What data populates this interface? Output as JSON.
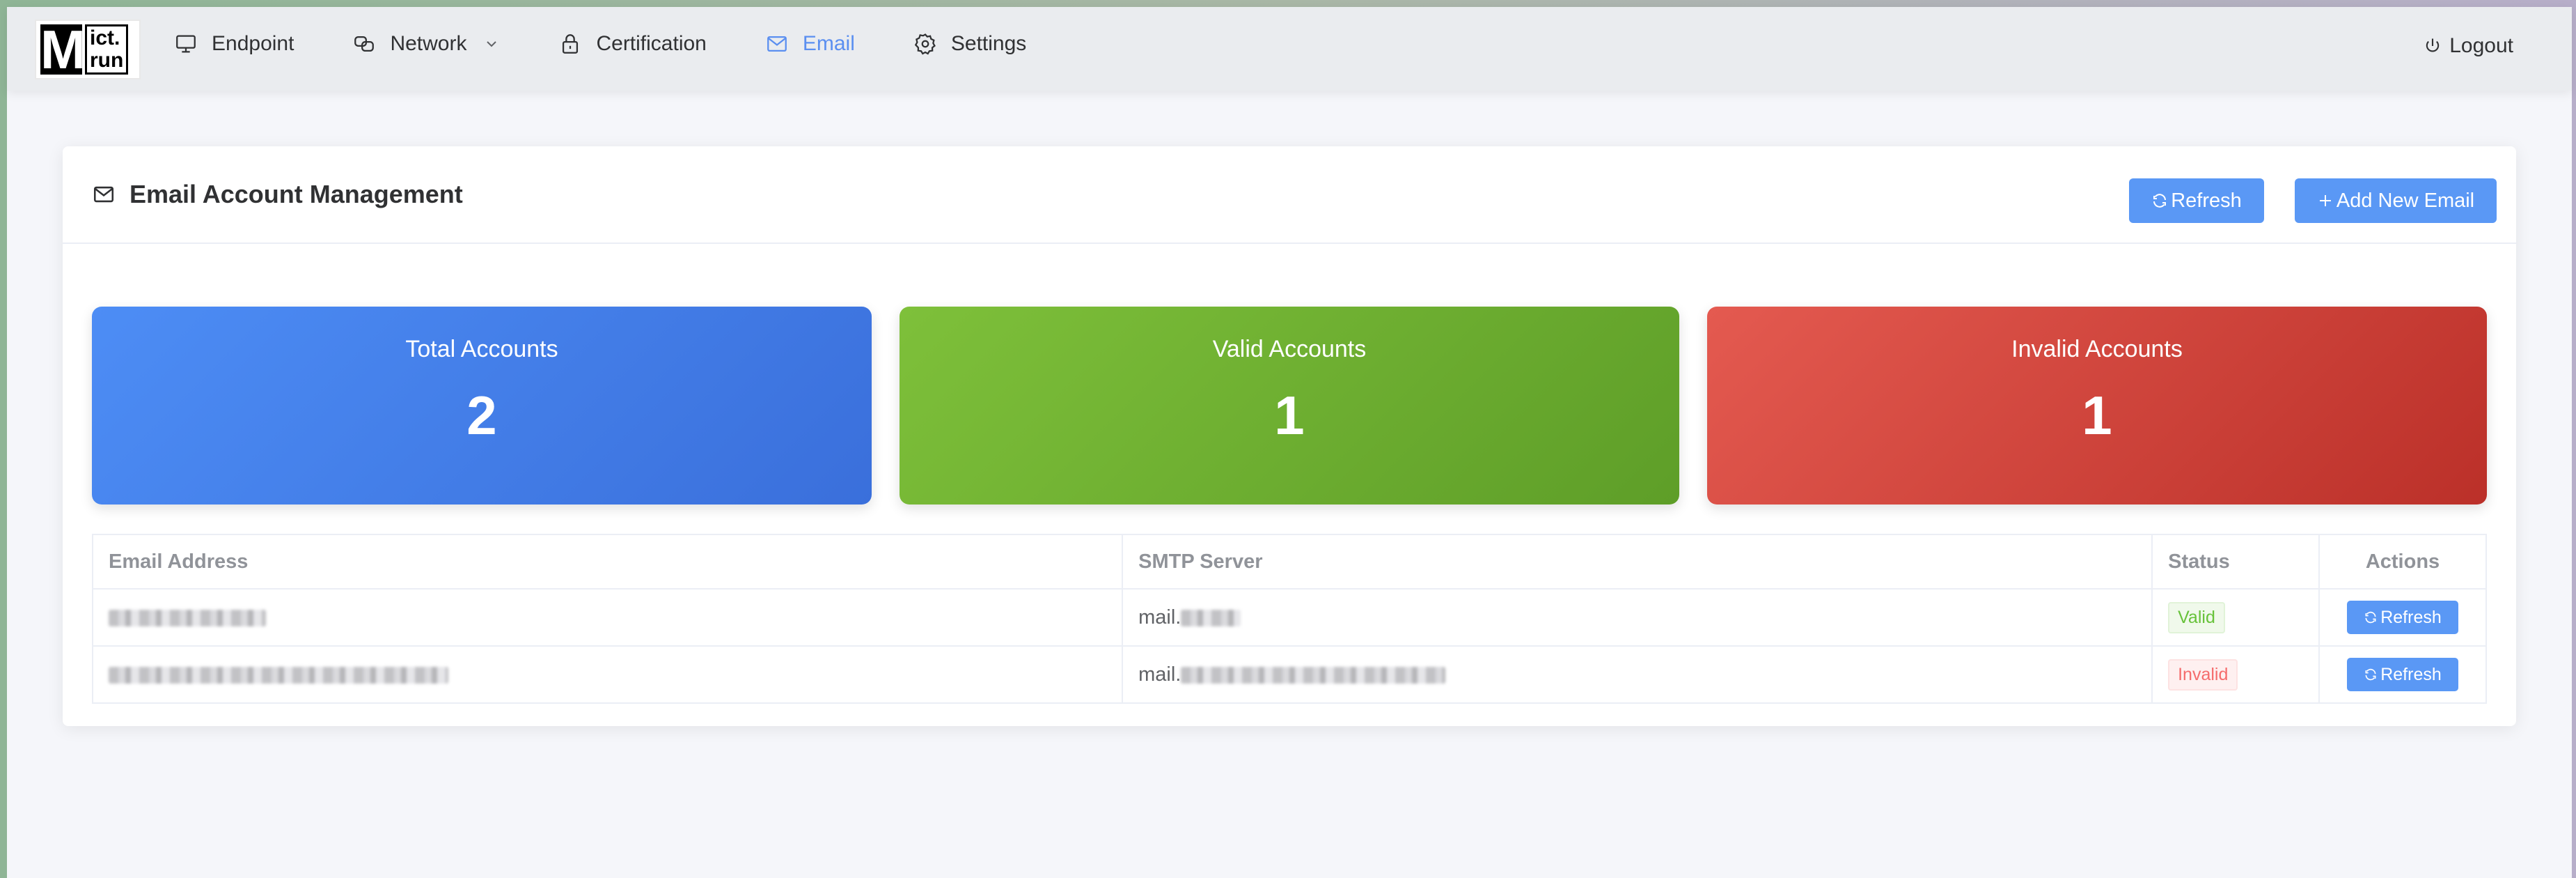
{
  "logo": {
    "mark": "M",
    "line1": "ict.",
    "line2": "run"
  },
  "nav": {
    "items": [
      {
        "label": "Endpoint",
        "icon": "monitor-icon"
      },
      {
        "label": "Network",
        "icon": "network-icon"
      },
      {
        "label": "Certification",
        "icon": "lock-icon"
      },
      {
        "label": "Email",
        "icon": "mail-icon",
        "active": true
      },
      {
        "label": "Settings",
        "icon": "gear-icon"
      }
    ],
    "logout": "Logout"
  },
  "card": {
    "title": "Email Account Management",
    "refresh_label": "Refresh",
    "add_label": "Add New Email"
  },
  "stats": [
    {
      "label": "Total Accounts",
      "value": "2",
      "color": "#3f7ce6"
    },
    {
      "label": "Valid Accounts",
      "value": "1",
      "color": "#6cae30"
    },
    {
      "label": "Invalid Accounts",
      "value": "1",
      "color": "#d1443b"
    }
  ],
  "table": {
    "headers": [
      "Email Address",
      "SMTP Server",
      "Status",
      "Actions"
    ],
    "rows": [
      {
        "smtp_prefix": "mail.",
        "status": "Valid",
        "action": "Refresh"
      },
      {
        "smtp_prefix": "mail.",
        "status": "Invalid",
        "action": "Refresh"
      }
    ]
  },
  "colors": {
    "accent": "#5a98f5",
    "valid": "#67c23a",
    "invalid": "#f56c6c"
  }
}
